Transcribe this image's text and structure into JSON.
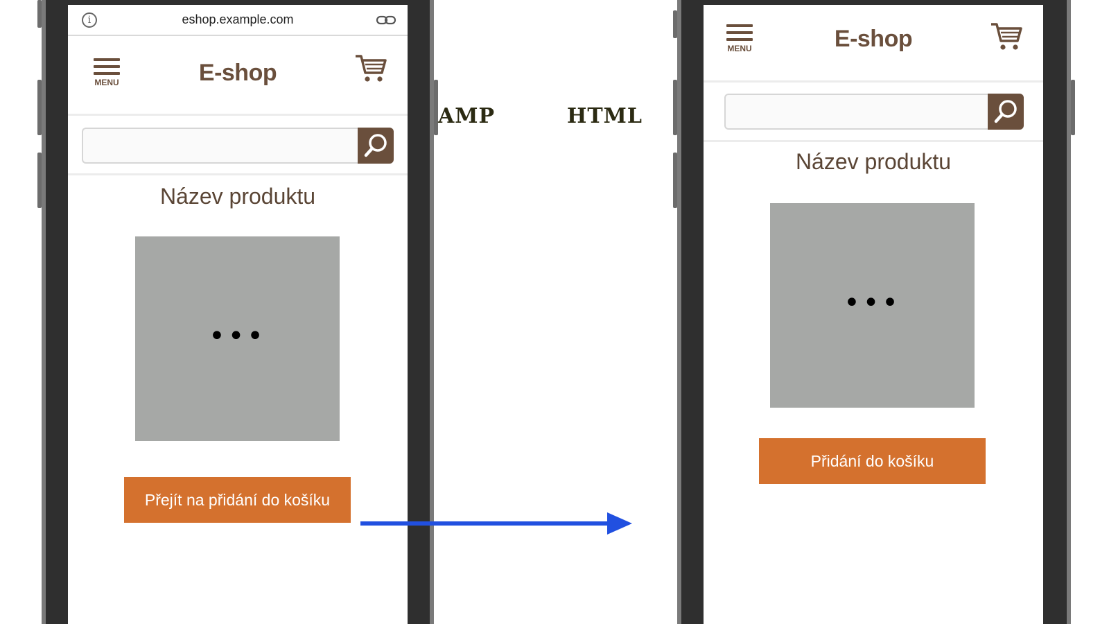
{
  "labels": {
    "left": "AMP",
    "right": "HTML"
  },
  "amp_phone": {
    "url": "eshop.example.com",
    "menu_label": "MENU",
    "brand": "E-shop",
    "search_placeholder": "",
    "product_title": "Název produktu",
    "image_placeholder": "•••",
    "cta_label": "Přejít na přidání do košíku"
  },
  "html_phone": {
    "menu_label": "MENU",
    "brand": "E-shop",
    "search_placeholder": "",
    "product_title": "Název produktu",
    "image_placeholder": "•••",
    "cta_label": "Přidání do košíku"
  },
  "colors": {
    "brand_brown": "#6a4f3c",
    "cta_orange": "#d4712e",
    "image_gray": "#a6a8a6",
    "arrow_blue": "#2150e0"
  },
  "icons": [
    "info-icon",
    "link-icon",
    "menu-icon",
    "cart-icon",
    "search-icon",
    "arrow-right-icon"
  ]
}
